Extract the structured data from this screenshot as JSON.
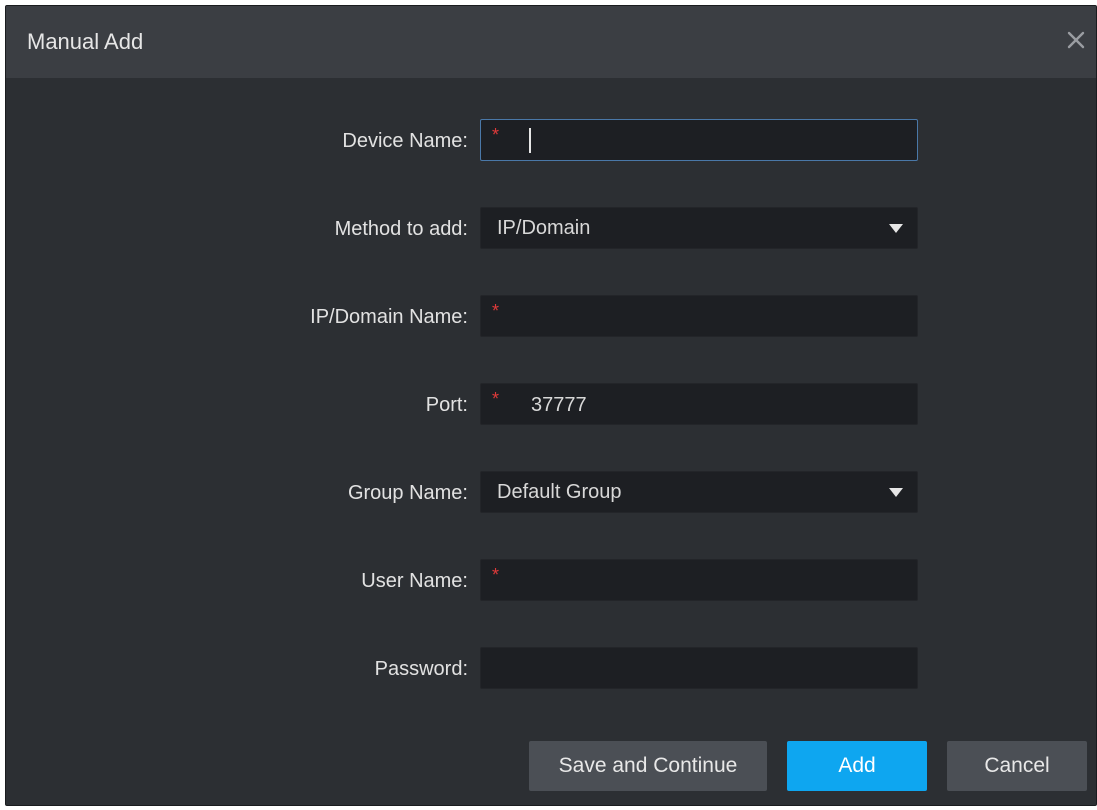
{
  "dialog": {
    "title": "Manual Add",
    "close_icon": "close-icon"
  },
  "form": {
    "device_name": {
      "label": "Device Name:",
      "value": "",
      "required_mark": "*"
    },
    "method_to_add": {
      "label": "Method to add:",
      "selected": "IP/Domain"
    },
    "ip_domain_name": {
      "label": "IP/Domain Name:",
      "value": "",
      "required_mark": "*"
    },
    "port": {
      "label": "Port:",
      "value": "37777",
      "required_mark": "*"
    },
    "group_name": {
      "label": "Group Name:",
      "selected": "Default Group"
    },
    "user_name": {
      "label": "User Name:",
      "value": "",
      "required_mark": "*"
    },
    "password": {
      "label": "Password:",
      "value": ""
    }
  },
  "buttons": {
    "save_and_continue": "Save and Continue",
    "add": "Add",
    "cancel": "Cancel"
  },
  "colors": {
    "dialog_bg": "#2c2f33",
    "titlebar_bg": "#3b3e43",
    "input_bg": "#1d1f23",
    "required": "#e03a3a",
    "primary": "#0ea6f0",
    "secondary": "#4b4f55"
  }
}
